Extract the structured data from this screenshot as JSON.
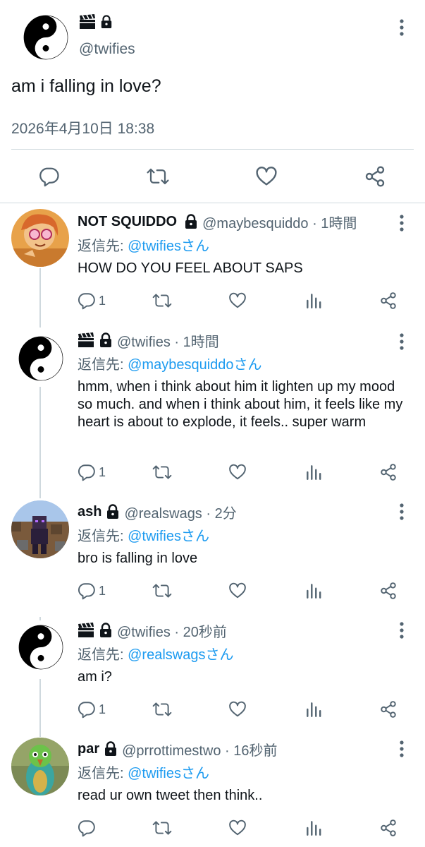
{
  "main": {
    "handle": "@twifies",
    "text": "am i falling in love?",
    "timestamp": "2026年4月10日 18:38"
  },
  "replies": [
    {
      "name": "NOT SQUIDDO",
      "handle": "@maybesquiddo · 1時間",
      "reply_prefix": "返信先: ",
      "reply_to": "@twifiesさん",
      "text": "HOW DO YOU FEEL ABOUT SAPS",
      "reply_count": "1",
      "avatar": "orange-character-avatar"
    },
    {
      "name": "",
      "handle": "@twifies · 1時間",
      "reply_prefix": "返信先: ",
      "reply_to": "@maybesquiddoさん",
      "text": "hmm, when i think about him it lighten up my mood so much. and when i think about him, it feels like my heart is about to explode, it feels.. super warm",
      "reply_count": "1",
      "avatar": "yin-yang-avatar"
    },
    {
      "name": "ash",
      "handle": "@realswags · 2分",
      "reply_prefix": "返信先: ",
      "reply_to": "@twifiesさん",
      "text": "bro is falling in love",
      "reply_count": "1",
      "avatar": "minecraft-avatar"
    },
    {
      "name": "",
      "handle": "@twifies · 20秒前",
      "reply_prefix": "返信先: ",
      "reply_to": "@realswagsさん",
      "text": "am i?",
      "reply_count": "1",
      "avatar": "yin-yang-avatar"
    },
    {
      "name": "par",
      "handle": "@prrottimestwo · 16秒前",
      "reply_prefix": "返信先: ",
      "reply_to": "@twifiesさん",
      "text": "read ur own tweet then think..",
      "reply_count": "",
      "avatar": "parrot-avatar"
    }
  ],
  "colors": {
    "text": "#0f1419",
    "secondary": "#536471",
    "link": "#1d9bf0",
    "border": "#cfd9de"
  }
}
